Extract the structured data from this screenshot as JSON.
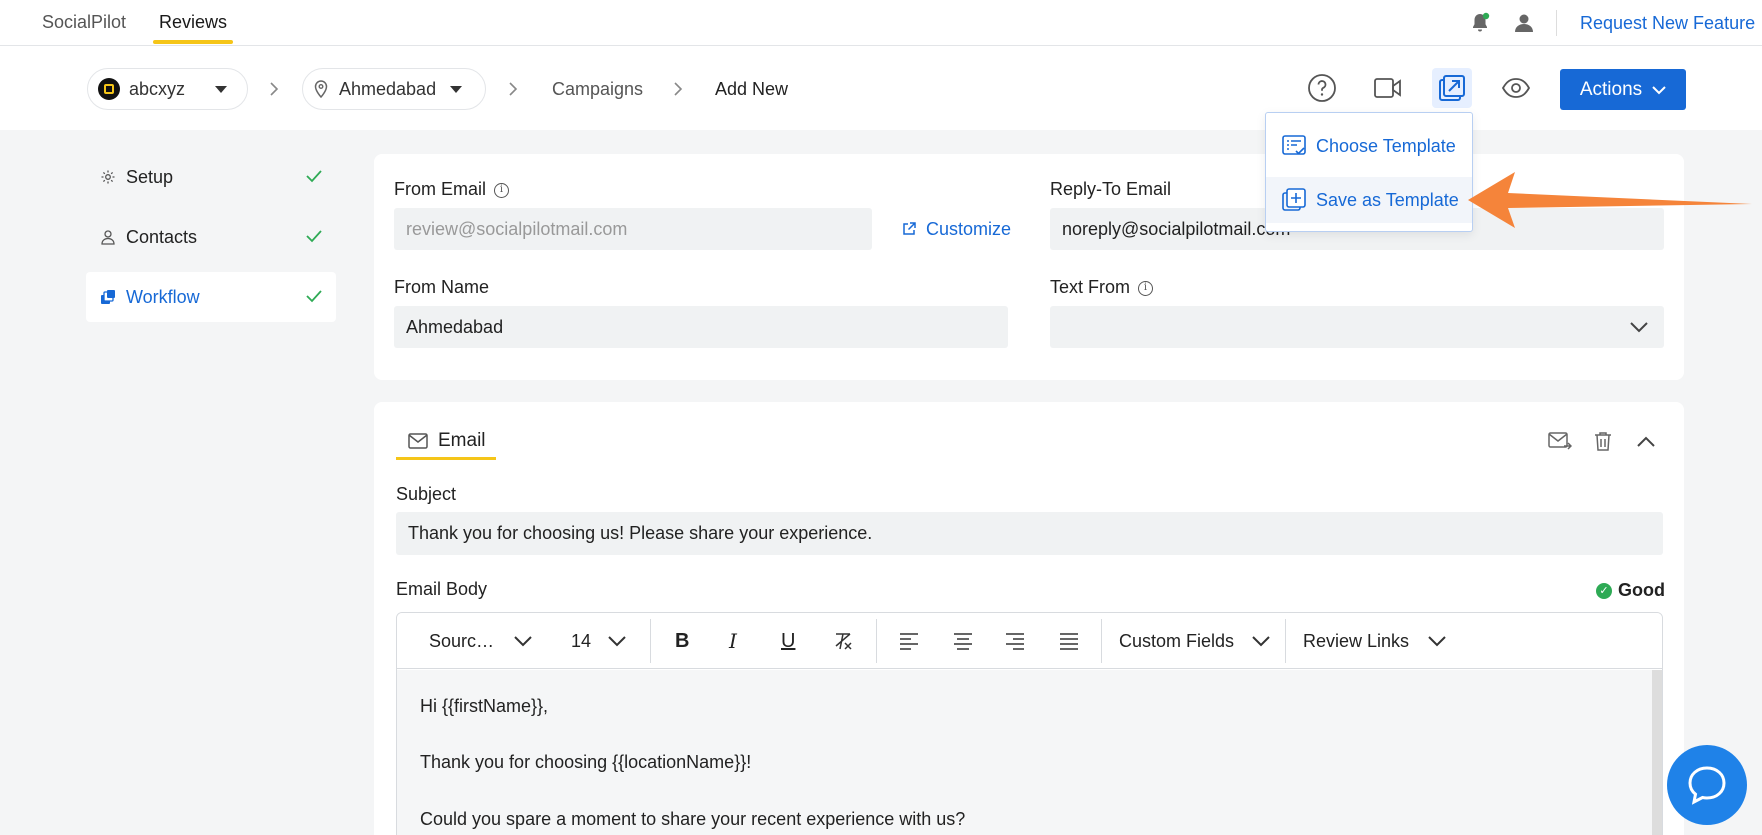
{
  "topnav": {
    "tabs": [
      {
        "label": "SocialPilot",
        "active": false
      },
      {
        "label": "Reviews",
        "active": true
      }
    ],
    "request_feature": "Request New Feature"
  },
  "breadcrumb": {
    "account": "abcxyz",
    "location": "Ahmedabad",
    "section": "Campaigns",
    "current": "Add New"
  },
  "toolbar_icons": [
    "help-icon",
    "video-icon",
    "template-icon",
    "preview-icon"
  ],
  "actions_label": "Actions",
  "template_menu": {
    "items": [
      {
        "label": "Choose Template",
        "icon": "choose-template-icon"
      },
      {
        "label": "Save as Template",
        "icon": "save-template-icon"
      }
    ]
  },
  "left_menu": {
    "items": [
      {
        "label": "Setup",
        "icon": "gear-icon",
        "done": true
      },
      {
        "label": "Contacts",
        "icon": "user-icon",
        "done": true
      },
      {
        "label": "Workflow",
        "icon": "workflow-icon",
        "done": true,
        "active": true
      }
    ]
  },
  "sender": {
    "from_email_label": "From Email",
    "from_email_placeholder": "review@socialpilotmail.com",
    "customize_label": "Customize",
    "reply_to_label": "Reply-To Email",
    "reply_to_value": "noreply@socialpilotmail.com",
    "from_name_label": "From Name",
    "from_name_value": "Ahmedabad",
    "text_from_label": "Text From",
    "text_from_value": ""
  },
  "email": {
    "tab_label": "Email",
    "subject_label": "Subject",
    "subject_value": "Thank you for choosing us! Please share your experience.",
    "body_label": "Email Body",
    "quality": "Good",
    "editor_toolbar": {
      "font": "Sourc…",
      "size": "14",
      "custom_fields": "Custom Fields",
      "review_links": "Review Links"
    },
    "body_lines": [
      "Hi {{firstName}},",
      "Thank you for choosing {{locationName}}!",
      "Could you spare a moment to share your recent experience with us?"
    ]
  },
  "colors": {
    "primary": "#1769d6",
    "accent_yellow": "#f5c518",
    "success": "#2eaa55",
    "annotation_arrow": "#f5843a"
  }
}
